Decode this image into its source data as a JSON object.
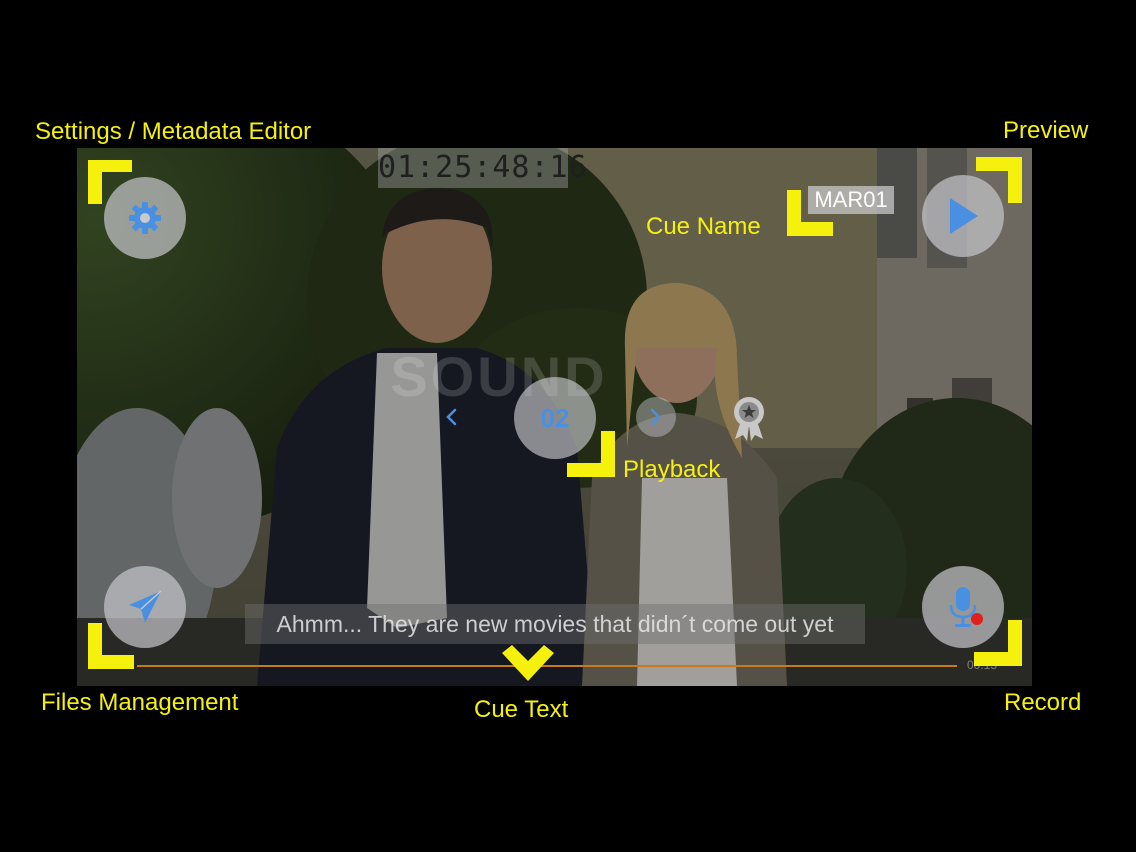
{
  "video": {
    "timecode": "01:25:48:16",
    "cue_name": "MAR01",
    "watermark": "SOUND",
    "playback_counter": "02",
    "prev_icon": "chevron-left-icon",
    "next_icon": "chevron-right-icon",
    "award_icon": "award-badge-icon",
    "subtitle": "Ahmm... They are new movies that didn´t come out yet",
    "time_elapsed": "00:15",
    "time_total": "00:15"
  },
  "buttons": {
    "settings_icon": "gear-icon",
    "preview_icon": "play-icon",
    "files_icon": "paper-plane-icon",
    "record_icon": "microphone-icon"
  },
  "callouts": {
    "settings": "Settings / Metadata Editor",
    "preview": "Preview",
    "cue_name": "Cue Name",
    "playback": "Playback",
    "files": "Files Management",
    "cue_text": "Cue Text",
    "record": "Record"
  },
  "colors": {
    "callout": "#f5f10d",
    "accent": "#4a90e2",
    "progress": "#c87a1a",
    "record_dot": "#e0201a"
  }
}
